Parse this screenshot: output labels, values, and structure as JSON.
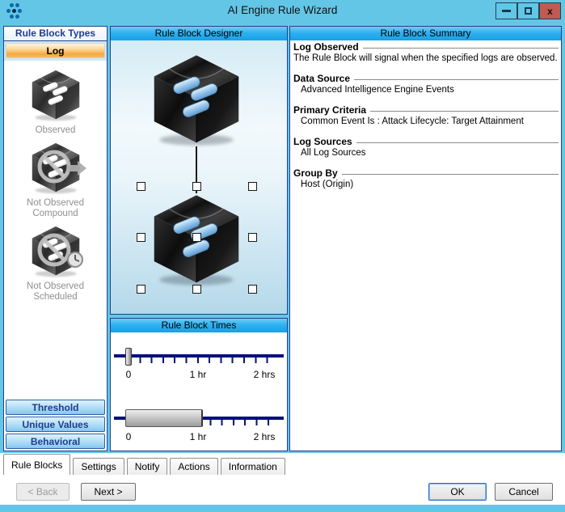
{
  "window": {
    "title": "AI Engine Rule Wizard",
    "controls": {
      "close_glyph": "x"
    }
  },
  "rule_block_types": {
    "header": "Rule Block Types",
    "selected_type": "Log",
    "items": [
      {
        "label": "Observed",
        "icon": "cube-observed-icon"
      },
      {
        "label": "Not Observed Compound",
        "icon": "cube-not-observed-compound-icon"
      },
      {
        "label": "Not Observed Scheduled",
        "icon": "cube-not-observed-scheduled-icon"
      }
    ],
    "more_type_buttons": [
      {
        "label": "Threshold"
      },
      {
        "label": "Unique Values"
      },
      {
        "label": "Behavioral"
      }
    ]
  },
  "designer": {
    "header": "Rule Block Designer"
  },
  "times": {
    "header": "Rule Block Times",
    "timeline1": {
      "labels": [
        "0",
        "1 hr",
        "2 hrs"
      ],
      "handle_position": "0"
    },
    "timeline2": {
      "labels": [
        "0",
        "1 hr",
        "2 hrs"
      ],
      "range": "0 to 1 hr"
    }
  },
  "summary": {
    "header": "Rule Block Summary",
    "sections": [
      {
        "title": "Log Observed",
        "text": "The Rule Block will signal when the specified logs are observed."
      },
      {
        "title": "Data Source",
        "text": "Advanced Intelligence Engine Events"
      },
      {
        "title": "Primary Criteria",
        "text": "Common Event Is : Attack Lifecycle: Target Attainment"
      },
      {
        "title": "Log Sources",
        "text": "All Log Sources"
      },
      {
        "title": "Group By",
        "text": "Host (Origin)"
      }
    ]
  },
  "tabs": [
    {
      "label": "Rule Blocks",
      "active": true
    },
    {
      "label": "Settings",
      "active": false
    },
    {
      "label": "Notify",
      "active": false
    },
    {
      "label": "Actions",
      "active": false
    },
    {
      "label": "Information",
      "active": false
    }
  ],
  "footer_buttons": {
    "back": "< Back",
    "next": "Next >",
    "ok": "OK",
    "cancel": "Cancel"
  },
  "colors": {
    "titlebar": "#63C6E6",
    "header_blue": "#2FB1F0",
    "accent_orange": "#F5A93C",
    "panel_border": "#24418D",
    "close_red": "#C05B52",
    "timeline_navy": "#000F7E"
  }
}
